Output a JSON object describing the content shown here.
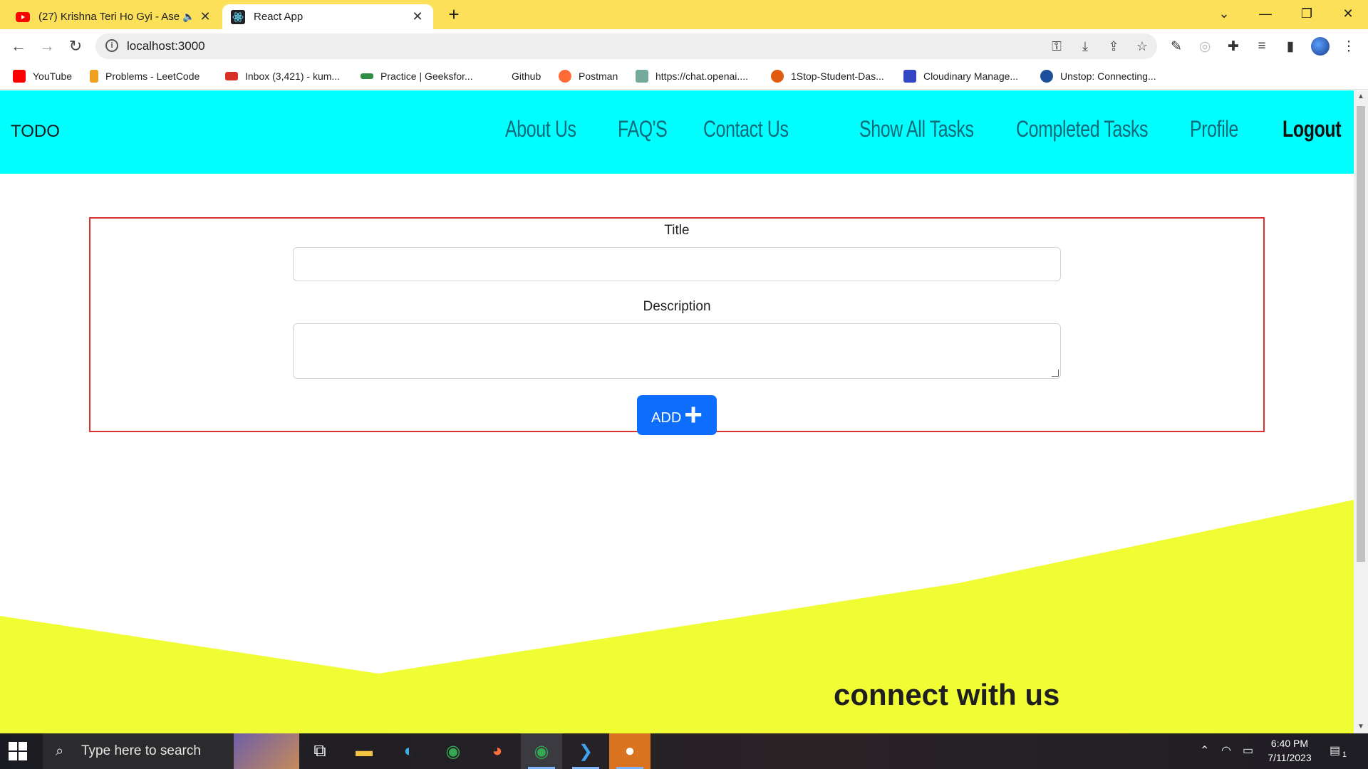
{
  "browser": {
    "tabs": [
      {
        "title": "(27) Krishna Teri Ho Gyi - Ase",
        "active": false
      },
      {
        "title": "React App",
        "active": true
      }
    ],
    "url": "localhost:3000",
    "bookmarks": [
      {
        "label": "YouTube",
        "color": "#ff0000"
      },
      {
        "label": "Problems - LeetCode",
        "color": "#f0a020"
      },
      {
        "label": "Inbox (3,421) - kum...",
        "color": "#d93025"
      },
      {
        "label": "Practice | Geeksfor...",
        "color": "#2f8d46"
      },
      {
        "label": "Github",
        "color": ""
      },
      {
        "label": "Postman",
        "color": "#ff6c37"
      },
      {
        "label": "https://chat.openai....",
        "color": "#74aa9c"
      },
      {
        "label": "1Stop-Student-Das...",
        "color": "#e05a10"
      },
      {
        "label": "Cloudinary Manage...",
        "color": "#3448c5"
      },
      {
        "label": "Unstop: Connecting...",
        "color": "#1c4f9c"
      }
    ]
  },
  "navbar": {
    "brand": "TODO",
    "links": [
      "About Us",
      "FAQ'S",
      "Contact Us",
      "Show All Tasks",
      "Completed Tasks",
      "Profile"
    ],
    "logout": "Logout",
    "bg_color": "#00ffff"
  },
  "form": {
    "title_label": "Title",
    "title_value": "",
    "description_label": "Description",
    "description_value": "",
    "add_label": "ADD",
    "add_icon": "+",
    "border_color": "#e03131",
    "button_color": "#0d6efd"
  },
  "footer": {
    "connect_heading": "connect with us",
    "wave_color": "#f1fd34"
  },
  "taskbar": {
    "search_placeholder": "Type here to search",
    "time": "6:40 PM",
    "date": "7/11/2023",
    "notification_count": "1"
  }
}
